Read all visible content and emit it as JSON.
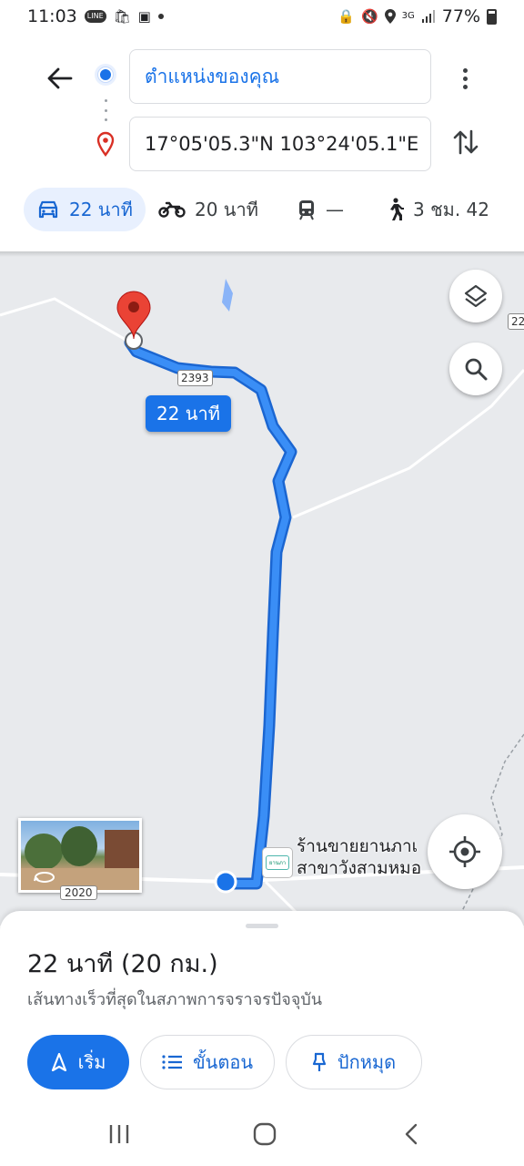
{
  "status_bar": {
    "time": "11:03",
    "left_icons": [
      "line-icon",
      "shopee-icon",
      "gallery-icon",
      "notification-dot-icon"
    ],
    "right_icons": [
      "lock-icon",
      "mute-icon",
      "location-icon",
      "3g-icon",
      "signal-icon",
      "battery-icon"
    ],
    "network": "3G",
    "battery": "77%"
  },
  "directions": {
    "origin": "ตำแหน่งของคุณ",
    "destination": "17°05'05.3\"N 103°24'05.1\"E"
  },
  "modes": [
    {
      "name": "car",
      "label": "22 นาที",
      "active": true
    },
    {
      "name": "motorcycle",
      "label": "20 นาที",
      "active": false
    },
    {
      "name": "transit",
      "label": "—",
      "active": false
    },
    {
      "name": "walk",
      "label": "3 ชม. 42",
      "active": false
    }
  ],
  "map": {
    "route_duration_label": "22 นาที",
    "road_shield_top": "2393",
    "road_shield_edge": "22",
    "road_shield_bottom": "2020",
    "poi_label_line1": "ร้านขายยานภาเ",
    "poi_label_line2": "สาขาวังสามหมอ",
    "poi_logo_text": "ยานภา",
    "colors": {
      "route": "#3a8ef6",
      "route_border": "#1b66d1",
      "pin": "#ea4335",
      "map_bg": "#e8eaed"
    }
  },
  "sheet": {
    "duration": "22 นาที (20 กม.)",
    "subtitle": "เส้นทางเร็วที่สุดในสภาพการจราจรปัจจุบัน",
    "start_label": "เริ่ม",
    "steps_label": "ขั้นตอน",
    "pin_label": "ปักหมุด"
  },
  "nav": [
    "recent-apps",
    "home",
    "back"
  ]
}
